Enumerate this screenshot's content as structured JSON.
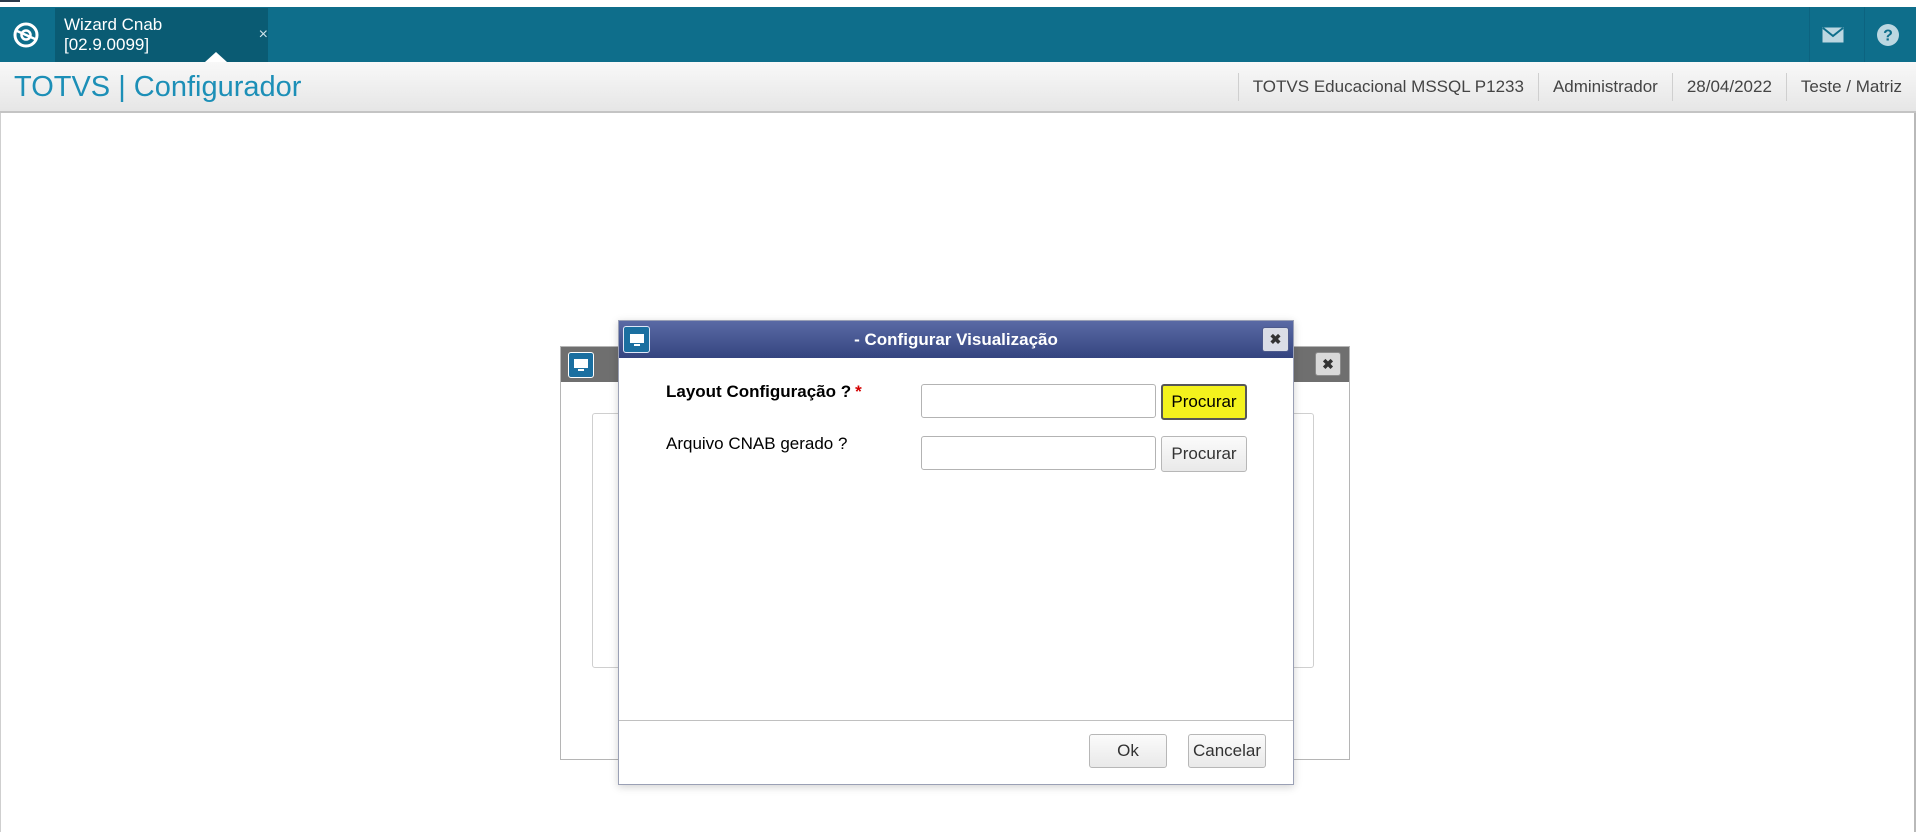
{
  "topbar": {
    "tab_label": "Wizard Cnab [02.9.0099]",
    "tab_close": "×",
    "logo_icon": "totvs-logo-icon",
    "mail_icon": "envelope-icon",
    "help_icon": "question-icon",
    "color": "#0e6e8b"
  },
  "header": {
    "app_title": "TOTVS | Configurador",
    "environment": "TOTVS Educacional MSSQL P1233",
    "user": "Administrador",
    "date": "28/04/2022",
    "branch": "Teste / Matriz"
  },
  "background_window": {
    "close_label": "✖"
  },
  "dialog": {
    "title": "- Configurar Visualização",
    "close_label": "✖",
    "fields": [
      {
        "label": "Layout Configuração ?",
        "required_mark": "*",
        "value": "",
        "button_label": "Procurar"
      },
      {
        "label": "Arquivo CNAB gerado ?",
        "value": "",
        "button_label": "Procurar"
      }
    ],
    "ok_label": "Ok",
    "cancel_label": "Cancelar",
    "highlight_color": "#f4f21d"
  }
}
